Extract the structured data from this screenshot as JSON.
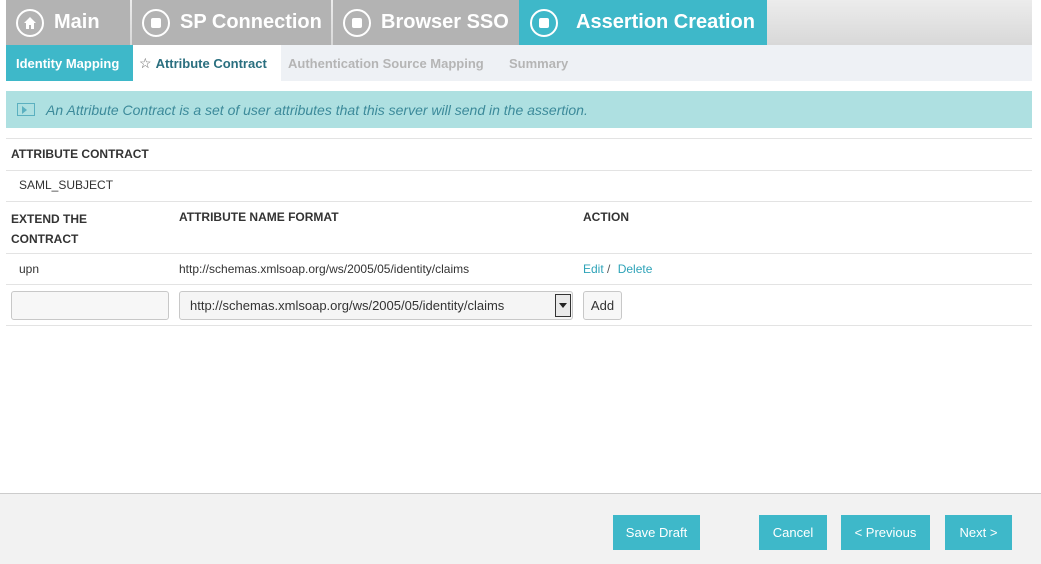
{
  "topnav": {
    "main": "Main",
    "sp_connection": "SP Connection",
    "browser_sso": "Browser SSO",
    "assertion_creation": "Assertion Creation"
  },
  "subnav": {
    "identity_mapping": "Identity Mapping",
    "attribute_contract": "Attribute Contract",
    "auth_source_mapping": "Authentication Source Mapping",
    "summary": "Summary"
  },
  "info": {
    "text": "An Attribute Contract is a set of user attributes that this server will send in the assertion."
  },
  "contract": {
    "header": "ATTRIBUTE CONTRACT",
    "subject": "SAML_SUBJECT"
  },
  "extend": {
    "col_extend_line1": "EXTEND THE",
    "col_extend_line2": "CONTRACT",
    "col_format": "ATTRIBUTE NAME FORMAT",
    "col_action": "ACTION",
    "rows": [
      {
        "name": "upn",
        "format": "http://schemas.xmlsoap.org/ws/2005/05/identity/claims",
        "edit": "Edit",
        "sep": "/",
        "delete": "Delete"
      }
    ],
    "new_name_value": "",
    "new_format_selected": "http://schemas.xmlsoap.org/ws/2005/05/identity/claims",
    "add_label": "Add"
  },
  "footer": {
    "save_draft": "Save Draft",
    "cancel": "Cancel",
    "previous": "< Previous",
    "next": "Next >"
  },
  "colors": {
    "accent": "#3eb8c9",
    "inactive_step": "#b3b3b3",
    "info_bg": "#aee0e1",
    "link": "#2ea3b8"
  },
  "icons": {
    "main": "home-icon",
    "steps": "stop-circle-icon",
    "current_tab": "star-icon",
    "info": "info-panel-icon",
    "select": "chevron-down-icon"
  }
}
